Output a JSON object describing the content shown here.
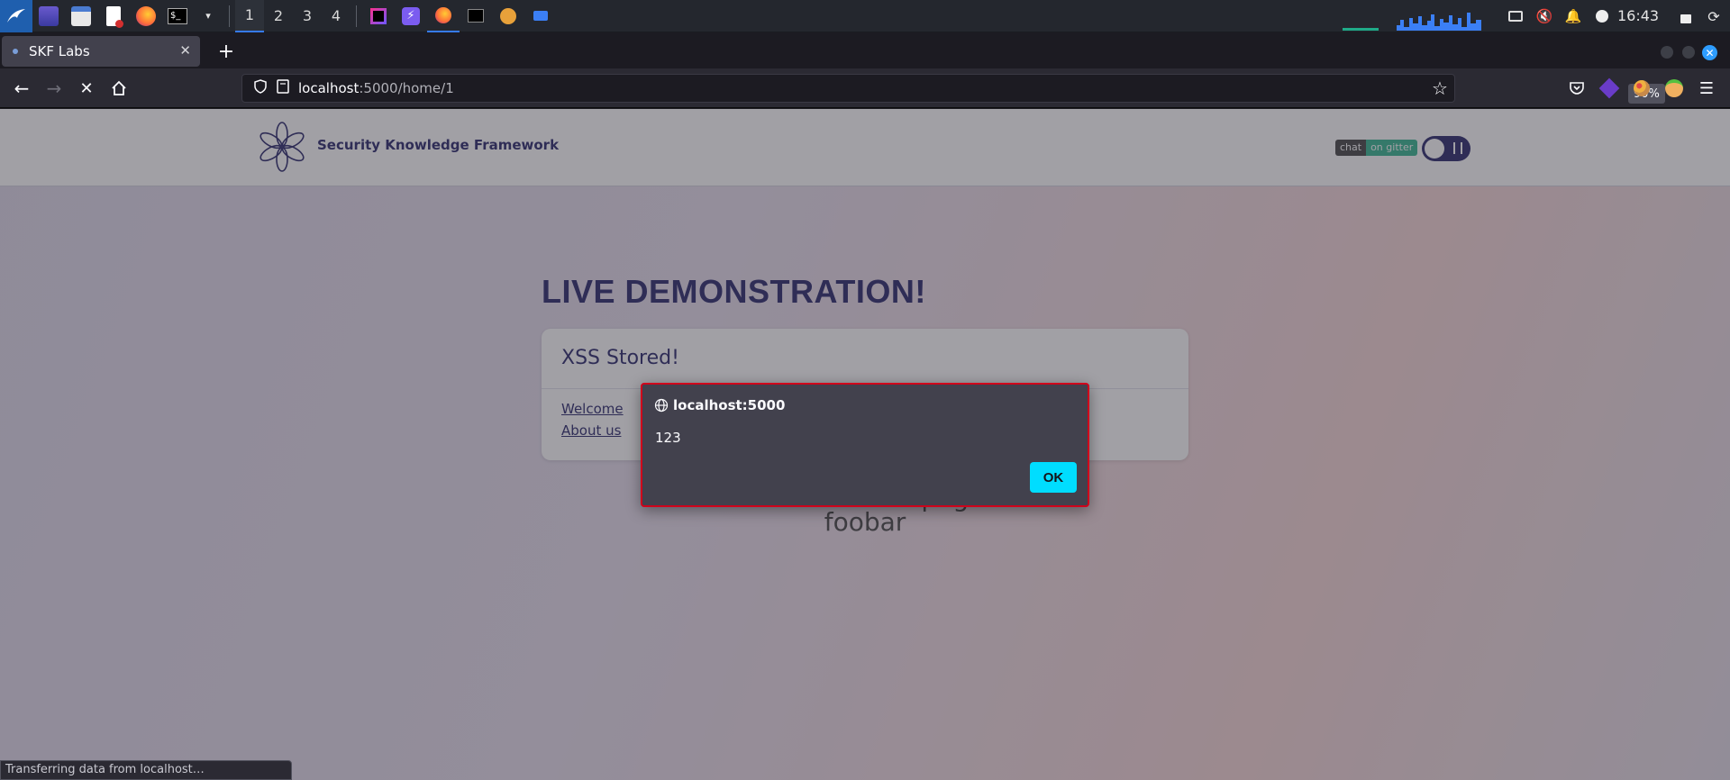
{
  "taskbar": {
    "workspaces": [
      "1",
      "2",
      "3",
      "4"
    ],
    "clock": "16:43"
  },
  "tab": {
    "title": "SKF Labs"
  },
  "navbar": {
    "url_host": "localhost",
    "url_path": ":5000/home/1",
    "zoom": "90%"
  },
  "site": {
    "brand": "Security Knowledge Framework",
    "gitter_left": "chat",
    "gitter_right": "on gitter",
    "headline": "LIVE DEMONSTRATION!",
    "card_title": "XSS Stored!",
    "links": [
      "Welcome",
      "About us"
    ],
    "body_line1": "The welcome page",
    "body_line2": "foobar"
  },
  "dialog": {
    "origin": "localhost:5000",
    "message": "123",
    "ok_label": "OK"
  },
  "status": {
    "text": "Transferring data from localhost…"
  },
  "colors": {
    "accent": "#3c3a78",
    "dialog_border": "#d0021b",
    "ok_button": "#00ddff"
  }
}
